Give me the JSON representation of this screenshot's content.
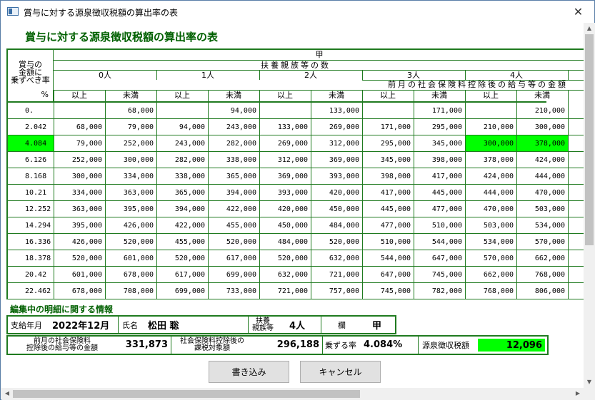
{
  "window": {
    "title": "賞与に対する源泉徴収税額の算出率の表",
    "close_glyph": "✕"
  },
  "heading": "賞与に対する源泉徴収税額の算出率の表",
  "table": {
    "rate_header": [
      "賞与の",
      "金額に",
      "乗ずべき率"
    ],
    "percent": "%",
    "group": "甲",
    "dependents_label": "扶養親族等の数",
    "dependent_columns": [
      "0人",
      "1人",
      "2人",
      "3人",
      "4人"
    ],
    "prev_salary_label": "前月の社会保険料控除後の給与等の金額",
    "sub_headers": [
      "以上",
      "未満"
    ],
    "rows": [
      {
        "rate": "0.",
        "values": [
          "",
          "68,000",
          "",
          "94,000",
          "",
          "133,000",
          "",
          "171,000",
          "",
          "210,000"
        ]
      },
      {
        "rate": "2.042",
        "values": [
          "68,000",
          "79,000",
          "94,000",
          "243,000",
          "133,000",
          "269,000",
          "171,000",
          "295,000",
          "210,000",
          "300,000"
        ]
      },
      {
        "rate": "4.084",
        "values": [
          "79,000",
          "252,000",
          "243,000",
          "282,000",
          "269,000",
          "312,000",
          "295,000",
          "345,000",
          "300,000",
          "378,000"
        ],
        "highlight": true
      },
      {
        "rate": "6.126",
        "values": [
          "252,000",
          "300,000",
          "282,000",
          "338,000",
          "312,000",
          "369,000",
          "345,000",
          "398,000",
          "378,000",
          "424,000"
        ]
      },
      {
        "rate": "8.168",
        "values": [
          "300,000",
          "334,000",
          "338,000",
          "365,000",
          "369,000",
          "393,000",
          "398,000",
          "417,000",
          "424,000",
          "444,000"
        ]
      },
      {
        "rate": "10.21",
        "values": [
          "334,000",
          "363,000",
          "365,000",
          "394,000",
          "393,000",
          "420,000",
          "417,000",
          "445,000",
          "444,000",
          "470,000"
        ]
      },
      {
        "rate": "12.252",
        "values": [
          "363,000",
          "395,000",
          "394,000",
          "422,000",
          "420,000",
          "450,000",
          "445,000",
          "477,000",
          "470,000",
          "503,000"
        ]
      },
      {
        "rate": "14.294",
        "values": [
          "395,000",
          "426,000",
          "422,000",
          "455,000",
          "450,000",
          "484,000",
          "477,000",
          "510,000",
          "503,000",
          "534,000"
        ]
      },
      {
        "rate": "16.336",
        "values": [
          "426,000",
          "520,000",
          "455,000",
          "520,000",
          "484,000",
          "520,000",
          "510,000",
          "544,000",
          "534,000",
          "570,000"
        ]
      },
      {
        "rate": "18.378",
        "values": [
          "520,000",
          "601,000",
          "520,000",
          "617,000",
          "520,000",
          "632,000",
          "544,000",
          "647,000",
          "570,000",
          "662,000"
        ]
      },
      {
        "rate": "20.42",
        "values": [
          "601,000",
          "678,000",
          "617,000",
          "699,000",
          "632,000",
          "721,000",
          "647,000",
          "745,000",
          "662,000",
          "768,000"
        ]
      },
      {
        "rate": "22.462",
        "values": [
          "678,000",
          "708,000",
          "699,000",
          "733,000",
          "721,000",
          "757,000",
          "745,000",
          "782,000",
          "768,000",
          "806,000"
        ]
      }
    ]
  },
  "details": {
    "section_label": "編集中の明細に関する情報",
    "pay_month_label": "支給年月",
    "pay_month": "2022年12月",
    "name_label": "氏名",
    "name": "松田 聡",
    "dependents_label_1": "扶養",
    "dependents_label_2": "親族等",
    "dependents": "4人",
    "column_label": "欄",
    "column": "甲",
    "prev_salary_label_1": "前月の社会保険料",
    "prev_salary_label_2": "控除後の給与等の金額",
    "prev_salary": "331,873",
    "taxable_label_1": "社会保険料控除後の",
    "taxable_label_2": "課税対象額",
    "taxable": "296,188",
    "rate_label": "乗ずる率",
    "rate": "4.084%",
    "tax_label": "源泉徴収税額",
    "tax": "12,096"
  },
  "buttons": {
    "write": "書き込み",
    "cancel": "キャンセル"
  },
  "colors": {
    "accent_green": "#006000",
    "grid_green": "#1f7a1f",
    "highlight": "#00ff00"
  }
}
